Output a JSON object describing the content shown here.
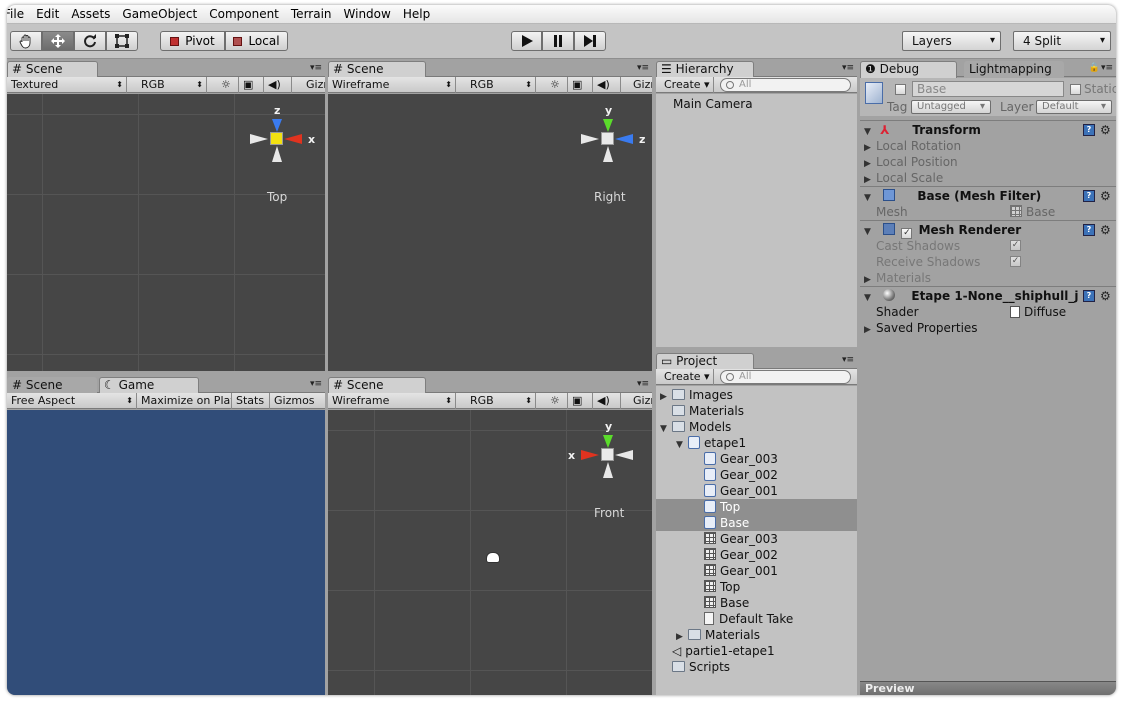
{
  "menu": [
    "File",
    "Edit",
    "Assets",
    "GameObject",
    "Component",
    "Terrain",
    "Window",
    "Help"
  ],
  "toolbar": {
    "tools": [
      "hand-icon",
      "move-icon",
      "rotate-icon",
      "scale-icon"
    ],
    "pivot_label": "Pivot",
    "local_label": "Local",
    "layers_label": "Layers",
    "layout_label": "4 Split"
  },
  "scene_top": {
    "tab": "Scene",
    "draw_mode": "Textured",
    "render_mode": "RGB",
    "gizmos": "Gizm",
    "axis_labels": {
      "up": "z",
      "right": "x"
    },
    "view_label": "Top"
  },
  "scene_right": {
    "tab": "Scene",
    "draw_mode": "Wireframe",
    "render_mode": "RGB",
    "gizmos": "Gizm",
    "axis_labels": {
      "up": "y",
      "right": "z"
    },
    "view_label": "Right"
  },
  "game": {
    "tabs": [
      "Scene",
      "Game"
    ],
    "aspect": "Free Aspect",
    "maximize": "Maximize on Play",
    "stats": "Stats",
    "gizmos": "Gizmos",
    "bg_color": "#314d79"
  },
  "scene_front": {
    "tab": "Scene",
    "draw_mode": "Wireframe",
    "render_mode": "RGB",
    "gizmos": "Gizm",
    "axis_labels": {
      "up": "y",
      "left": "x"
    },
    "view_label": "Front"
  },
  "hierarchy": {
    "tab": "Hierarchy",
    "create": "Create",
    "search_placeholder": "All",
    "items": [
      "Main Camera"
    ]
  },
  "project": {
    "tab": "Project",
    "create": "Create",
    "search_placeholder": "All",
    "items": [
      {
        "label": "Images",
        "icon": "folder-icon",
        "indent": 0,
        "arrow": "▶"
      },
      {
        "label": "Materials",
        "icon": "folder-icon",
        "indent": 0,
        "arrow": ""
      },
      {
        "label": "Models",
        "icon": "folder-icon",
        "indent": 0,
        "arrow": "▼"
      },
      {
        "label": "etape1",
        "icon": "model-icon",
        "indent": 1,
        "arrow": "▼"
      },
      {
        "label": "Gear_003",
        "icon": "model-icon",
        "indent": 2,
        "arrow": ""
      },
      {
        "label": "Gear_002",
        "icon": "model-icon",
        "indent": 2,
        "arrow": ""
      },
      {
        "label": "Gear_001",
        "icon": "model-icon",
        "indent": 2,
        "arrow": ""
      },
      {
        "label": "Top",
        "icon": "model-icon",
        "indent": 2,
        "arrow": "",
        "selected": true
      },
      {
        "label": "Base",
        "icon": "model-icon",
        "indent": 2,
        "arrow": "",
        "selected": true
      },
      {
        "label": "Gear_003",
        "icon": "mesh-icon",
        "indent": 2,
        "arrow": ""
      },
      {
        "label": "Gear_002",
        "icon": "mesh-icon",
        "indent": 2,
        "arrow": ""
      },
      {
        "label": "Gear_001",
        "icon": "mesh-icon",
        "indent": 2,
        "arrow": ""
      },
      {
        "label": "Top",
        "icon": "mesh-icon",
        "indent": 2,
        "arrow": ""
      },
      {
        "label": "Base",
        "icon": "mesh-icon",
        "indent": 2,
        "arrow": ""
      },
      {
        "label": "Default Take",
        "icon": "animation-icon",
        "indent": 2,
        "arrow": ""
      },
      {
        "label": "Materials",
        "icon": "folder-icon",
        "indent": 1,
        "arrow": "▶"
      },
      {
        "label": "partie1-etape1",
        "icon": "unity-scene-icon",
        "indent": 0,
        "arrow": ""
      },
      {
        "label": "Scripts",
        "icon": "folder-icon",
        "indent": 0,
        "arrow": ""
      }
    ]
  },
  "inspector": {
    "tabs": [
      "Debug",
      "Lightmapping"
    ],
    "object_name": "Base",
    "static_label": "Static",
    "tag_label": "Tag",
    "tag_value": "Untagged",
    "layer_label": "Layer",
    "layer_value": "Default",
    "transform": {
      "title": "Transform",
      "rows": [
        "Local Rotation",
        "Local Position",
        "Local Scale"
      ]
    },
    "mesh_filter": {
      "title": "Base (Mesh Filter)",
      "mesh_label": "Mesh",
      "mesh_value": "Base"
    },
    "mesh_renderer": {
      "title": "Mesh Renderer",
      "cast": "Cast Shadows",
      "receive": "Receive Shadows",
      "materials": "Materials"
    },
    "material": {
      "title": "Etape 1-None__shiphull_j",
      "shader_label": "Shader",
      "shader_value": "Diffuse",
      "saved": "Saved Properties"
    },
    "preview": "Preview"
  }
}
